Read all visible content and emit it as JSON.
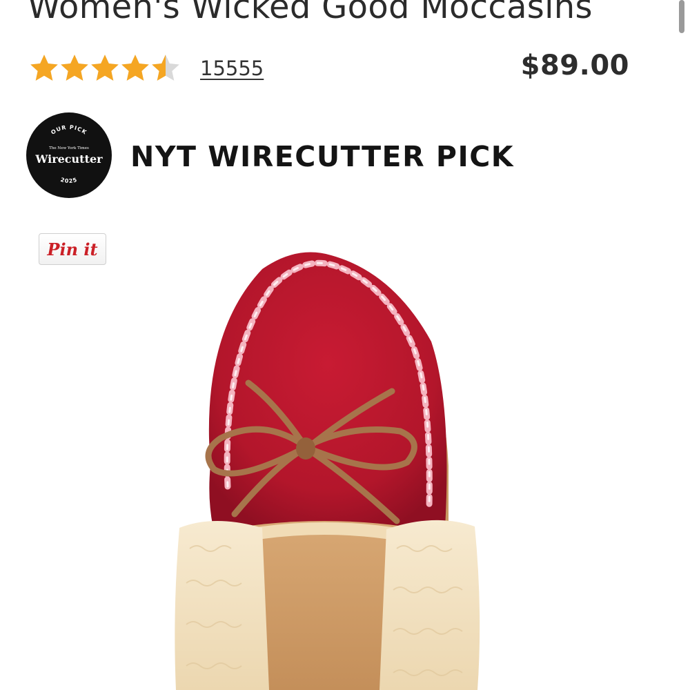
{
  "product": {
    "title": "Women's Wicked Good Moccasins",
    "rating": 4.5,
    "rating_max": 5,
    "review_count": "15555",
    "price": "$89.00"
  },
  "badge": {
    "label": "NYT WIRECUTTER PICK",
    "logo_text": "Wirecutter",
    "logo_top": "OUR PICK",
    "logo_small": "The New York Times",
    "logo_year": "2025"
  },
  "pin": {
    "label": "Pin it"
  },
  "colors": {
    "star": "#f5a623",
    "star_empty": "#d9d9d9",
    "pin_red": "#cb2027",
    "shoe_red": "#b5162b",
    "lace_brown": "#a7744b",
    "fur": "#f3e3c3"
  },
  "icons": {
    "star": "star-icon",
    "badge": "wirecutter-badge-icon",
    "pin": "pinterest-pin-icon"
  }
}
